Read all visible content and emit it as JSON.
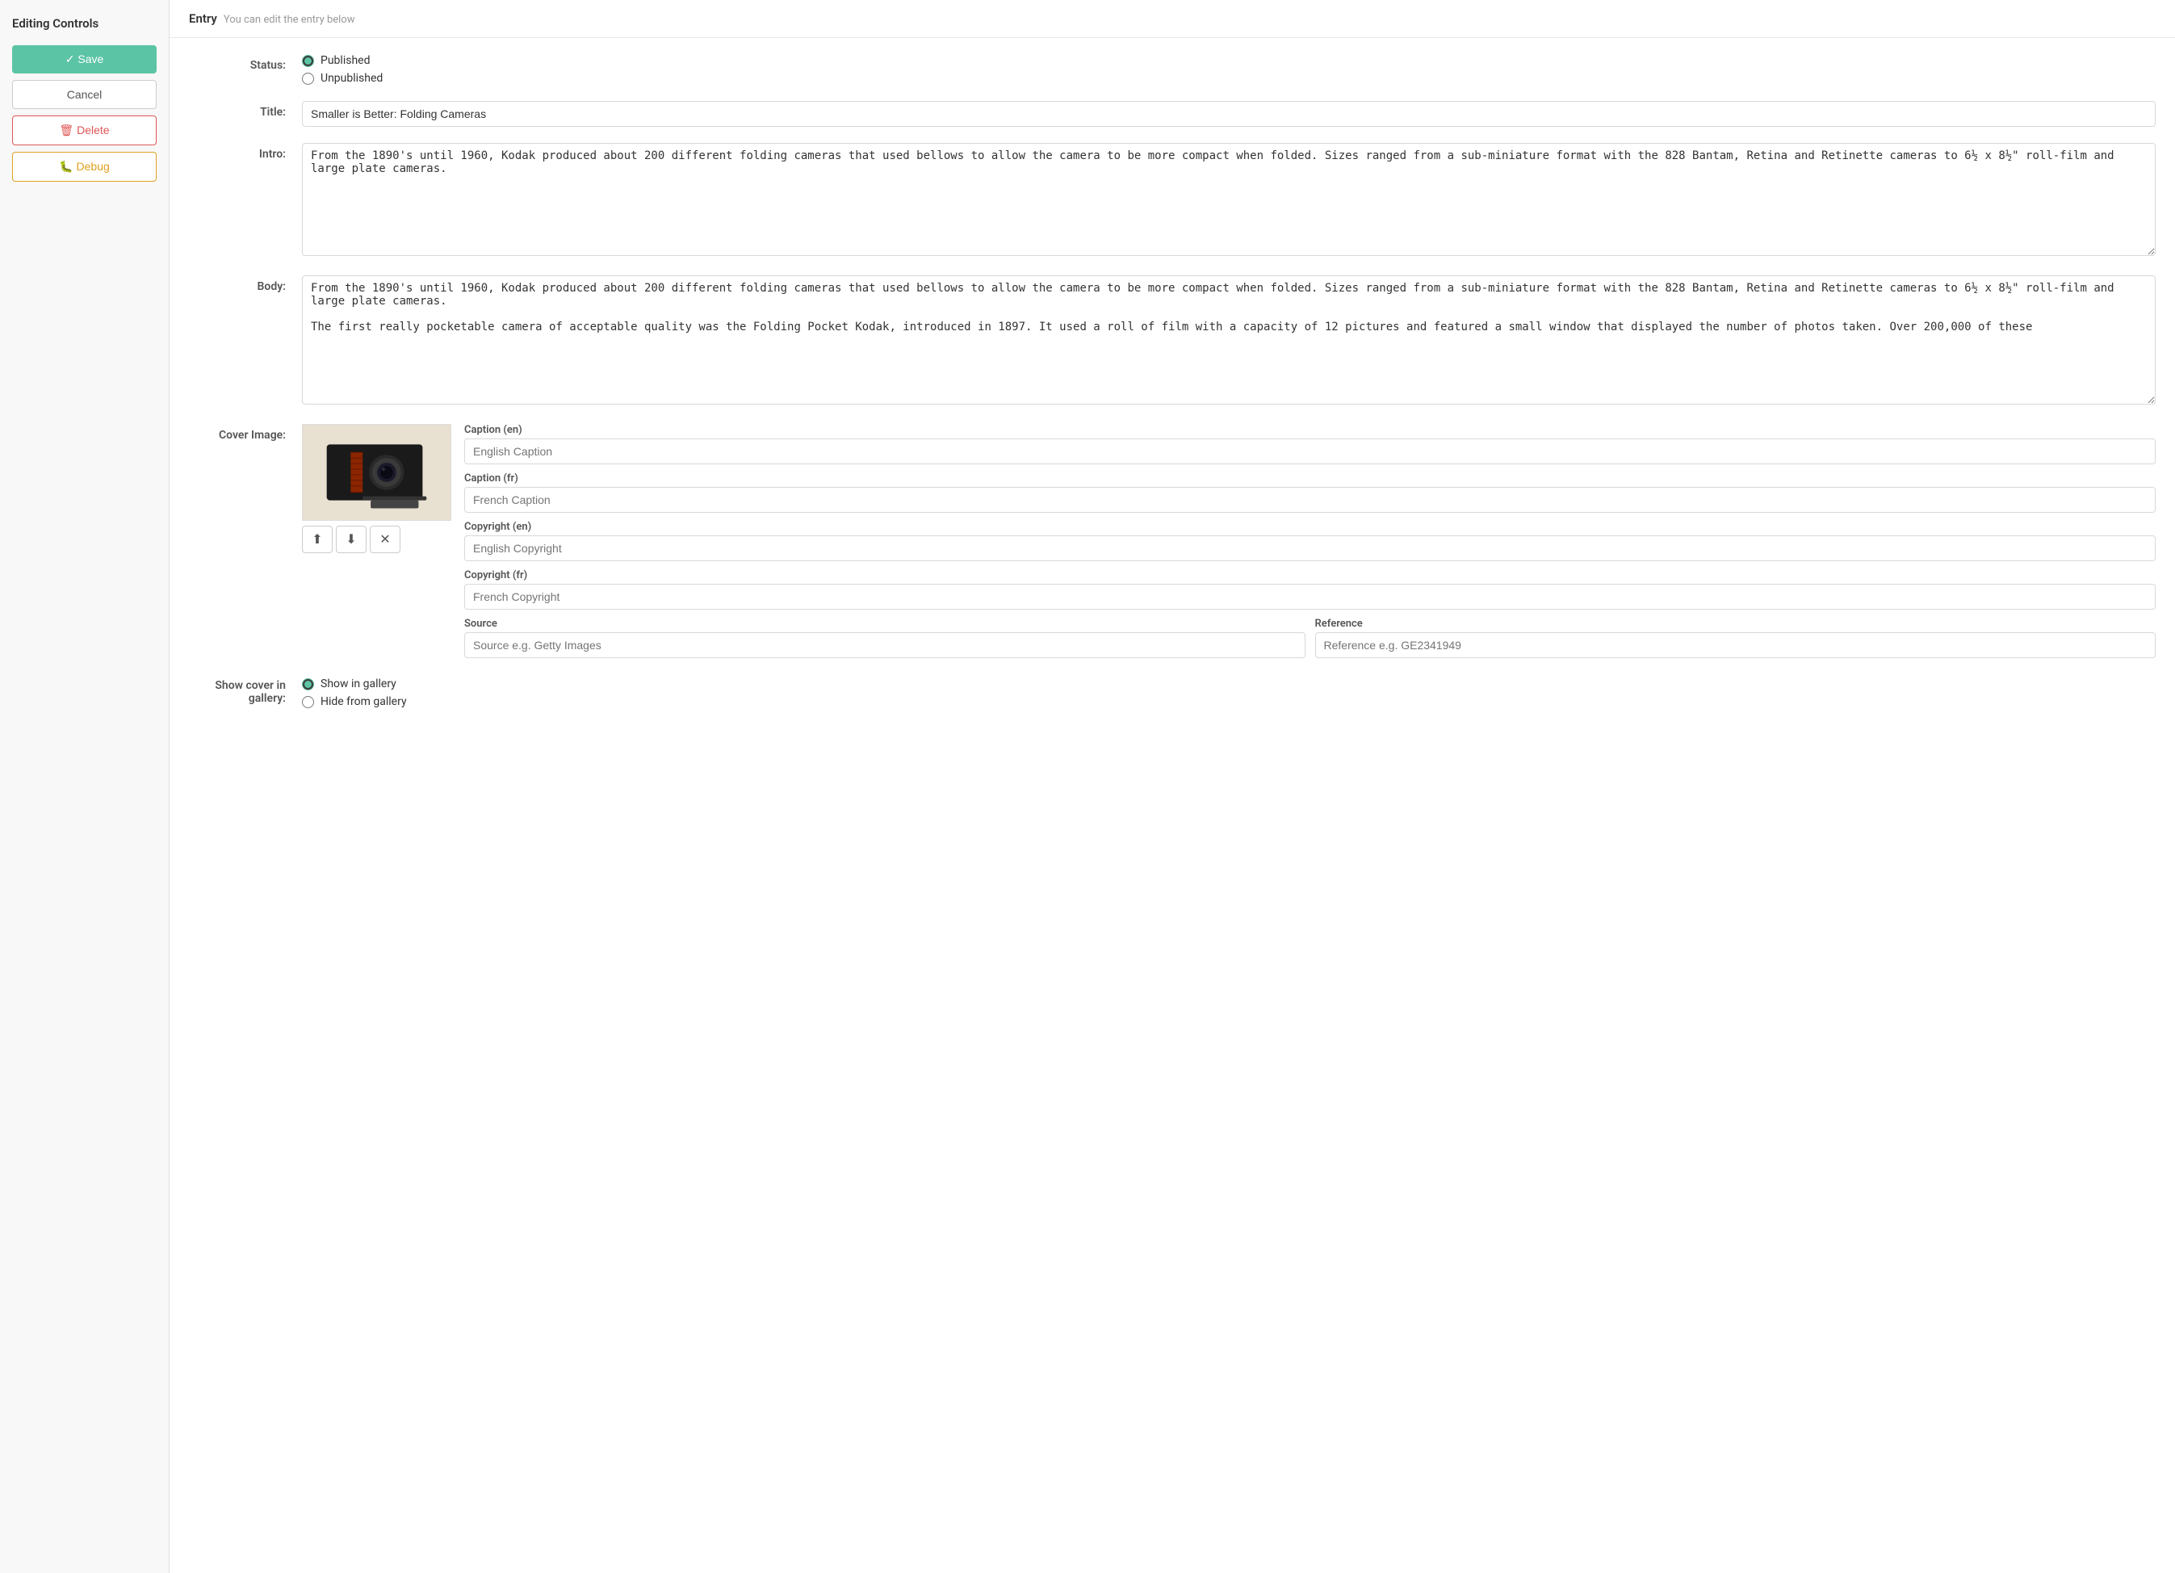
{
  "sidebar": {
    "title": "Editing Controls",
    "save_label": "✓ Save",
    "cancel_label": "Cancel",
    "delete_label": "🗑 Delete",
    "debug_label": "🐛 Debug"
  },
  "entry": {
    "header_title": "Entry",
    "header_subtitle": "You can edit the entry below"
  },
  "form": {
    "status_label": "Status:",
    "status_options": [
      {
        "value": "published",
        "label": "Published",
        "checked": true
      },
      {
        "value": "unpublished",
        "label": "Unpublished",
        "checked": false
      }
    ],
    "title_label": "Title:",
    "title_value": "Smaller is Better: Folding Cameras",
    "intro_label": "Intro:",
    "intro_value": "From the 1890's until 1960, Kodak produced about 200 different folding cameras that used bellows to allow the camera to be more compact when folded. Sizes ranged from a sub-miniature format with the 828 Bantam, Retina and Retinette cameras to 6½ x 8½\" roll-film and large plate cameras.",
    "body_label": "Body:",
    "body_value": "From the 1890's until 1960, Kodak produced about 200 different folding cameras that used bellows to allow the camera to be more compact when folded. Sizes ranged from a sub-miniature format with the 828 Bantam, Retina and Retinette cameras to 6½ x 8½\" roll-film and large plate cameras.\n\nThe first really pocketable camera of acceptable quality was the Folding Pocket Kodak, introduced in 1897. It used a roll of film with a capacity of 12 pictures and featured a small window that displayed the number of photos taken. Over 200,000 of these",
    "cover_image_label": "Cover Image:",
    "caption_en_label": "Caption (en)",
    "caption_en_placeholder": "English Caption",
    "caption_fr_label": "Caption (fr)",
    "caption_fr_placeholder": "French Caption",
    "copyright_en_label": "Copyright (en)",
    "copyright_en_placeholder": "English Copyright",
    "copyright_fr_label": "Copyright (fr)",
    "copyright_fr_placeholder": "French Copyright",
    "source_label": "Source",
    "source_placeholder": "Source e.g. Getty Images",
    "reference_label": "Reference",
    "reference_placeholder": "Reference e.g. GE2341949",
    "show_cover_label": "Show cover in gallery:",
    "gallery_options": [
      {
        "value": "show",
        "label": "Show in gallery",
        "checked": true
      },
      {
        "value": "hide",
        "label": "Hide from gallery",
        "checked": false
      }
    ],
    "upload_icon": "⬆",
    "download_icon": "⬇",
    "remove_icon": "✕"
  }
}
